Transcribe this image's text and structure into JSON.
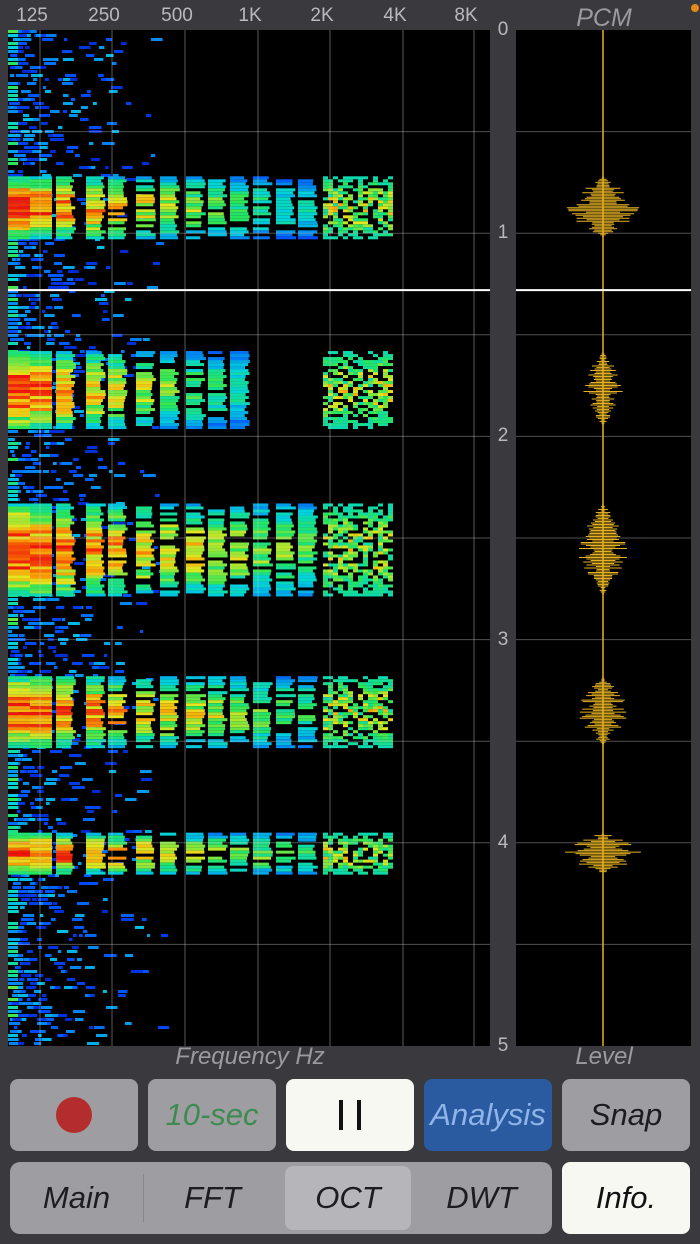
{
  "spectrogram": {
    "freq_ticks": [
      "125",
      "250",
      "500",
      "1K",
      "2K",
      "4K",
      "8K"
    ],
    "x_title": "Frequency Hz"
  },
  "pcm_panel": {
    "title": "PCM",
    "x_title": "Level"
  },
  "time_axis": {
    "ticks": [
      "0",
      "1",
      "2",
      "3",
      "4",
      "5"
    ],
    "cursor_seconds": 1.28
  },
  "controls": {
    "record_icon": "record-dot-icon",
    "duration_label": "10-sec",
    "pause_icon": "pause-icon",
    "analysis_label": "Analysis",
    "snap_label": "Snap",
    "info_label": "Info."
  },
  "mode_tabs": [
    {
      "label": "Main",
      "selected": false
    },
    {
      "label": "FFT",
      "selected": false
    },
    {
      "label": "OCT",
      "selected": true
    },
    {
      "label": "DWT",
      "selected": false
    }
  ],
  "colors": {
    "background": "#3a393e",
    "analysis_button": "#2a5aa0",
    "waveform": "#e6b222",
    "record_dot": "#b32d2d"
  }
}
